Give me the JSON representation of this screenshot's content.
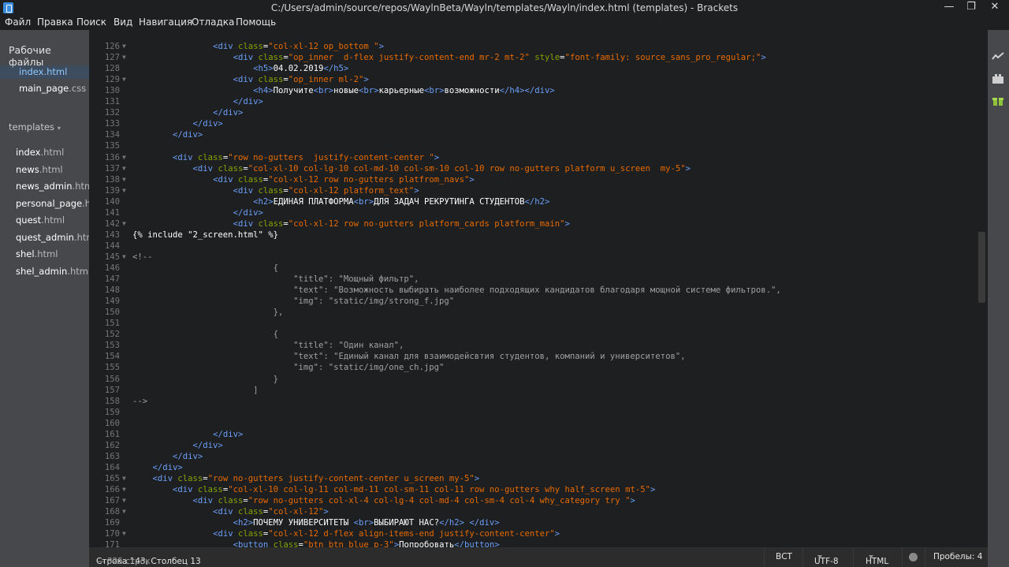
{
  "window": {
    "title": "C:/Users/admin/source/repos/WaylnBeta/Wayln/templates/Wayln/index.html (templates) - Brackets",
    "minimize": "—",
    "maximize": "❐",
    "close": "✕"
  },
  "menu": [
    "Файл",
    "Правка",
    "Поиск",
    "Вид",
    "Навигация",
    "Отладка",
    "Помощь"
  ],
  "sidebar": {
    "working_files_title": "Рабочие файлы",
    "working_files": [
      {
        "name": "index",
        "ext": ".html",
        "active": true
      },
      {
        "name": "main_page",
        "ext": ".css",
        "active": false
      }
    ],
    "project_title": "templates",
    "project_files": [
      {
        "name": "index",
        "ext": ".html"
      },
      {
        "name": "news",
        "ext": ".html"
      },
      {
        "name": "news_admin",
        "ext": ".htm"
      },
      {
        "name": "personal_page",
        "ext": ".ht"
      },
      {
        "name": "quest",
        "ext": ".html"
      },
      {
        "name": "quest_admin",
        "ext": ".htm"
      },
      {
        "name": "shel",
        "ext": ".html"
      },
      {
        "name": "shel_admin",
        "ext": ".html"
      }
    ]
  },
  "editor": {
    "lines": [
      {
        "n": "126",
        "f": "▼",
        "c": [
          [
            "x",
            "                "
          ],
          [
            "t",
            "<div "
          ],
          [
            "a",
            "class"
          ],
          [
            "x",
            "="
          ],
          [
            "s",
            "\"col-xl-12 op_bottom \""
          ],
          [
            "t",
            ">"
          ]
        ]
      },
      {
        "n": "127",
        "f": "▼",
        "c": [
          [
            "x",
            "                    "
          ],
          [
            "t",
            "<div "
          ],
          [
            "a",
            "class"
          ],
          [
            "x",
            "="
          ],
          [
            "s",
            "\"op_inner  d-flex justify-content-end mr-2 mt-2\""
          ],
          [
            "x",
            " "
          ],
          [
            "a",
            "style"
          ],
          [
            "x",
            "="
          ],
          [
            "s",
            "\"font-family: source_sans_pro_regular;\""
          ],
          [
            "t",
            ">"
          ]
        ]
      },
      {
        "n": "128",
        "f": "",
        "c": [
          [
            "x",
            "                        "
          ],
          [
            "t",
            "<h5>"
          ],
          [
            "x",
            "04.02.2019"
          ],
          [
            "t",
            "</h5>"
          ]
        ]
      },
      {
        "n": "129",
        "f": "▼",
        "c": [
          [
            "x",
            "                    "
          ],
          [
            "t",
            "<div "
          ],
          [
            "a",
            "class"
          ],
          [
            "x",
            "="
          ],
          [
            "s",
            "\"op_inner ml-2\""
          ],
          [
            "t",
            ">"
          ]
        ]
      },
      {
        "n": "130",
        "f": "",
        "c": [
          [
            "x",
            "                        "
          ],
          [
            "t",
            "<h4>"
          ],
          [
            "x",
            "Получите"
          ],
          [
            "t",
            "<br>"
          ],
          [
            "x",
            "новые"
          ],
          [
            "t",
            "<br>"
          ],
          [
            "x",
            "карьерные"
          ],
          [
            "t",
            "<br>"
          ],
          [
            "x",
            "возможности"
          ],
          [
            "t",
            "</h4></div>"
          ]
        ]
      },
      {
        "n": "131",
        "f": "",
        "c": [
          [
            "x",
            "                    "
          ],
          [
            "t",
            "</div>"
          ]
        ]
      },
      {
        "n": "132",
        "f": "",
        "c": [
          [
            "x",
            "                "
          ],
          [
            "t",
            "</div>"
          ]
        ]
      },
      {
        "n": "133",
        "f": "",
        "c": [
          [
            "x",
            "            "
          ],
          [
            "t",
            "</div>"
          ]
        ]
      },
      {
        "n": "134",
        "f": "",
        "c": [
          [
            "x",
            "        "
          ],
          [
            "t",
            "</div>"
          ]
        ]
      },
      {
        "n": "135",
        "f": "",
        "c": []
      },
      {
        "n": "136",
        "f": "▼",
        "c": [
          [
            "x",
            "        "
          ],
          [
            "t",
            "<div "
          ],
          [
            "a",
            "class"
          ],
          [
            "x",
            "="
          ],
          [
            "s",
            "\"row no-gutters  justify-content-center \""
          ],
          [
            "t",
            ">"
          ]
        ]
      },
      {
        "n": "137",
        "f": "▼",
        "c": [
          [
            "x",
            "            "
          ],
          [
            "t",
            "<div "
          ],
          [
            "a",
            "class"
          ],
          [
            "x",
            "="
          ],
          [
            "s",
            "\"col-xl-10 col-lg-10 col-md-10 col-sm-10 col-10 row no-gutters platform u_screen  my-5\""
          ],
          [
            "t",
            ">"
          ]
        ]
      },
      {
        "n": "138",
        "f": "▼",
        "c": [
          [
            "x",
            "                "
          ],
          [
            "t",
            "<div "
          ],
          [
            "a",
            "class"
          ],
          [
            "x",
            "="
          ],
          [
            "s",
            "\"col-xl-12 row no-gutters platfrom_navs\""
          ],
          [
            "t",
            ">"
          ]
        ]
      },
      {
        "n": "139",
        "f": "▼",
        "c": [
          [
            "x",
            "                    "
          ],
          [
            "t",
            "<div "
          ],
          [
            "a",
            "class"
          ],
          [
            "x",
            "="
          ],
          [
            "s",
            "\"col-xl-12 platform_text\""
          ],
          [
            "t",
            ">"
          ]
        ]
      },
      {
        "n": "140",
        "f": "",
        "c": [
          [
            "x",
            "                        "
          ],
          [
            "t",
            "<h2>"
          ],
          [
            "x",
            "ЕДИНАЯ ПЛАТФОРМА"
          ],
          [
            "t",
            "<br>"
          ],
          [
            "x",
            "ДЛЯ ЗАДАЧ РЕКРУТИНГА СТУДЕНТОВ"
          ],
          [
            "t",
            "</h2>"
          ]
        ]
      },
      {
        "n": "141",
        "f": "",
        "c": [
          [
            "x",
            "                    "
          ],
          [
            "t",
            "</div>"
          ]
        ]
      },
      {
        "n": "142",
        "f": "▼",
        "c": [
          [
            "x",
            "                    "
          ],
          [
            "t",
            "<div "
          ],
          [
            "a",
            "class"
          ],
          [
            "x",
            "="
          ],
          [
            "s",
            "\"col-xl-12 row no-gutters platform_cards platform_main\""
          ],
          [
            "t",
            ">"
          ]
        ]
      },
      {
        "n": "143",
        "f": "",
        "c": [
          [
            "x",
            "{% include \"2_screen.html\" %}"
          ]
        ]
      },
      {
        "n": "144",
        "f": "",
        "c": []
      },
      {
        "n": "145",
        "f": "▼",
        "c": [
          [
            "c",
            "<!--"
          ]
        ]
      },
      {
        "n": "146",
        "f": "",
        "c": [
          [
            "c",
            "                            {"
          ]
        ]
      },
      {
        "n": "147",
        "f": "",
        "c": [
          [
            "c",
            "                                \"title\": \"Мощный фильтр\","
          ]
        ]
      },
      {
        "n": "148",
        "f": "",
        "c": [
          [
            "c",
            "                                \"text\": \"Возможность выбирать наиболее подходящих кандидатов благодаря мощной системе фильтров.\","
          ]
        ]
      },
      {
        "n": "149",
        "f": "",
        "c": [
          [
            "c",
            "                                \"img\": \"static/img/strong_f.jpg\""
          ]
        ]
      },
      {
        "n": "150",
        "f": "",
        "c": [
          [
            "c",
            "                            },"
          ]
        ]
      },
      {
        "n": "151",
        "f": "",
        "c": []
      },
      {
        "n": "152",
        "f": "",
        "c": [
          [
            "c",
            "                            {"
          ]
        ]
      },
      {
        "n": "153",
        "f": "",
        "c": [
          [
            "c",
            "                                \"title\": \"Один канал\","
          ]
        ]
      },
      {
        "n": "154",
        "f": "",
        "c": [
          [
            "c",
            "                                \"text\": \"Единый канал для взаимодейсвтия студентов, компаний и университетов\","
          ]
        ]
      },
      {
        "n": "155",
        "f": "",
        "c": [
          [
            "c",
            "                                \"img\": \"static/img/one_ch.jpg\""
          ]
        ]
      },
      {
        "n": "156",
        "f": "",
        "c": [
          [
            "c",
            "                            }"
          ]
        ]
      },
      {
        "n": "157",
        "f": "",
        "c": [
          [
            "c",
            "                        ]"
          ]
        ]
      },
      {
        "n": "158",
        "f": "",
        "c": [
          [
            "c",
            "-->"
          ]
        ]
      },
      {
        "n": "159",
        "f": "",
        "c": []
      },
      {
        "n": "160",
        "f": "",
        "c": []
      },
      {
        "n": "161",
        "f": "",
        "c": [
          [
            "x",
            "                "
          ],
          [
            "t",
            "</div>"
          ]
        ]
      },
      {
        "n": "162",
        "f": "",
        "c": [
          [
            "x",
            "            "
          ],
          [
            "t",
            "</div>"
          ]
        ]
      },
      {
        "n": "163",
        "f": "",
        "c": [
          [
            "x",
            "        "
          ],
          [
            "t",
            "</div>"
          ]
        ]
      },
      {
        "n": "164",
        "f": "",
        "c": [
          [
            "x",
            "    "
          ],
          [
            "t",
            "</div>"
          ]
        ]
      },
      {
        "n": "165",
        "f": "▼",
        "c": [
          [
            "x",
            "    "
          ],
          [
            "t",
            "<div "
          ],
          [
            "a",
            "class"
          ],
          [
            "x",
            "="
          ],
          [
            "s",
            "\"row no-gutters justify-content-center u_screen my-5\""
          ],
          [
            "t",
            ">"
          ]
        ]
      },
      {
        "n": "166",
        "f": "▼",
        "c": [
          [
            "x",
            "        "
          ],
          [
            "t",
            "<div "
          ],
          [
            "a",
            "class"
          ],
          [
            "x",
            "="
          ],
          [
            "s",
            "\"col-xl-10 col-lg-11 col-md-11 col-sm-11 col-11 row no-gutters why half_screen mt-5\""
          ],
          [
            "t",
            ">"
          ]
        ]
      },
      {
        "n": "167",
        "f": "▼",
        "c": [
          [
            "x",
            "            "
          ],
          [
            "t",
            "<div "
          ],
          [
            "a",
            "class"
          ],
          [
            "x",
            "="
          ],
          [
            "s",
            "\"row no-gutters col-xl-4 col-lg-4 col-md-4 col-sm-4 col-4 why_category try \""
          ],
          [
            "t",
            ">"
          ]
        ]
      },
      {
        "n": "168",
        "f": "▼",
        "c": [
          [
            "x",
            "                "
          ],
          [
            "t",
            "<div "
          ],
          [
            "a",
            "class"
          ],
          [
            "x",
            "="
          ],
          [
            "s",
            "\"col-xl-12\""
          ],
          [
            "t",
            ">"
          ]
        ]
      },
      {
        "n": "169",
        "f": "",
        "c": [
          [
            "x",
            "                    "
          ],
          [
            "t",
            "<h2>"
          ],
          [
            "x",
            "ПОЧЕМУ УНИВЕРСИТЕТЫ "
          ],
          [
            "t",
            "<br>"
          ],
          [
            "x",
            "ВЫБИРАЮТ НАС?"
          ],
          [
            "t",
            "</h2> </div>"
          ]
        ]
      },
      {
        "n": "170",
        "f": "▼",
        "c": [
          [
            "x",
            "                "
          ],
          [
            "t",
            "<div "
          ],
          [
            "a",
            "class"
          ],
          [
            "x",
            "="
          ],
          [
            "s",
            "\"col-xl-12 d-flex align-items-end justify-content-center\""
          ],
          [
            "t",
            ">"
          ]
        ]
      },
      {
        "n": "171",
        "f": "",
        "c": [
          [
            "x",
            "                    "
          ],
          [
            "t",
            "<button "
          ],
          [
            "a",
            "class"
          ],
          [
            "x",
            "="
          ],
          [
            "s",
            "\"btn btn blue p-3\""
          ],
          [
            "t",
            ">"
          ],
          [
            "x",
            "Попробовать"
          ],
          [
            "t",
            "</button>"
          ]
        ]
      }
    ]
  },
  "status": {
    "cursor": "Строка 143, Столбец 13",
    "line_count": "— 325 строк",
    "mode": "ВСТ",
    "encoding": "UTF-8",
    "language": "HTML",
    "indent": "Пробелы: 4"
  }
}
